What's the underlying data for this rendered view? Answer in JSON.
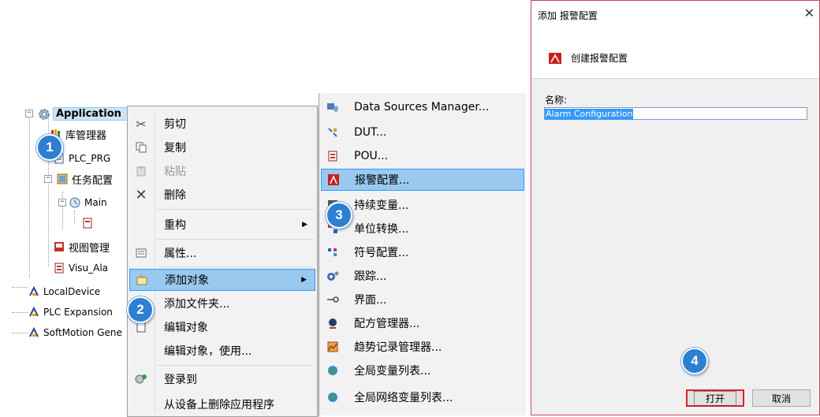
{
  "tree": {
    "items": [
      {
        "label": "Application"
      },
      {
        "label": "库管理器"
      },
      {
        "label": "PLC_PRG"
      },
      {
        "label": "任务配置"
      },
      {
        "label": "Main"
      },
      {
        "label": "视图管理"
      },
      {
        "label": "Visu_Ala"
      },
      {
        "label": "LocalDevice"
      },
      {
        "label": "PLC Expansion"
      },
      {
        "label": "SoftMotion Gene"
      }
    ]
  },
  "context_menu": {
    "items": [
      {
        "label": "剪切",
        "icon": "scissors-icon"
      },
      {
        "label": "复制",
        "icon": "copy-icon"
      },
      {
        "label": "粘贴",
        "icon": "paste-icon",
        "disabled": true
      },
      {
        "label": "删除",
        "icon": "delete-icon"
      },
      {
        "label": "重构",
        "icon": "",
        "has_submenu": true
      },
      {
        "label": "属性...",
        "icon": "properties-icon"
      },
      {
        "label": "添加对象",
        "icon": "add-object-icon",
        "has_submenu": true,
        "highlighted": true
      },
      {
        "label": "添加文件夹...",
        "icon": "folder-icon"
      },
      {
        "label": "编辑对象",
        "icon": "edit-icon"
      },
      {
        "label": "编辑对象，使用...",
        "icon": ""
      },
      {
        "label": "登录到",
        "icon": "login-icon"
      },
      {
        "label": "从设备上删除应用程序",
        "icon": ""
      }
    ]
  },
  "submenu": {
    "items": [
      {
        "label": "Data Sources Manager...",
        "icon": "data-sources-icon"
      },
      {
        "label": "DUT...",
        "icon": "dut-icon"
      },
      {
        "label": "POU...",
        "icon": "pou-icon"
      },
      {
        "label": "报警配置...",
        "icon": "alarm-config-icon",
        "highlighted": true
      },
      {
        "label": "持续变量...",
        "icon": "persistent-vars-icon"
      },
      {
        "label": "单位转换...",
        "icon": "unit-conversion-icon"
      },
      {
        "label": "符号配置...",
        "icon": "symbol-config-icon"
      },
      {
        "label": "跟踪...",
        "icon": "trace-icon"
      },
      {
        "label": "界面...",
        "icon": "interface-icon"
      },
      {
        "label": "配方管理器...",
        "icon": "recipe-icon"
      },
      {
        "label": "趋势记录管理器...",
        "icon": "trend-icon"
      },
      {
        "label": "全局变量列表...",
        "icon": "global-vars-icon"
      },
      {
        "label": "全局网络变量列表...",
        "icon": "network-vars-icon"
      }
    ]
  },
  "dialog": {
    "title": "添加 报警配置",
    "close": "✕",
    "heading": "创建报警配置",
    "name_label": "名称:",
    "name_value": "Alarm Configuration",
    "open_button": "打开",
    "cancel_button": "取消"
  },
  "badges": [
    "1",
    "2",
    "3",
    "4"
  ],
  "colors": {
    "badge": "#2e7fd0",
    "highlight": "#99c9ef",
    "highlight_border": "#3399ff",
    "open_button_border": "#e0202a"
  }
}
